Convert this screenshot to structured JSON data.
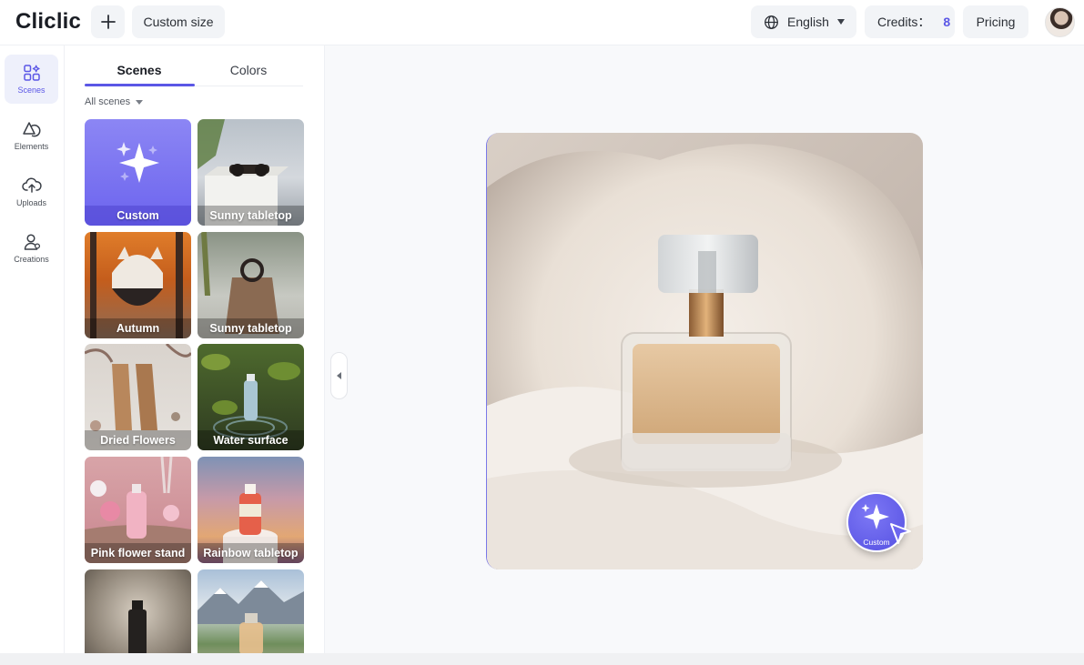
{
  "header": {
    "logo": "Cliclic",
    "custom_size_label": "Custom size",
    "language_label": "English",
    "credits_label": "Credits：",
    "credits_value": "8",
    "pricing_label": "Pricing"
  },
  "rail": {
    "items": [
      {
        "label": "Scenes",
        "icon": "grid-icon",
        "active": true
      },
      {
        "label": "Elements",
        "icon": "shapes-icon"
      },
      {
        "label": "Uploads",
        "icon": "cloud-upload-icon"
      },
      {
        "label": "Creations",
        "icon": "user-icon"
      }
    ]
  },
  "panel": {
    "tabs": [
      "Scenes",
      "Colors"
    ],
    "active_tab": "Scenes",
    "filter_label": "All scenes",
    "scenes": [
      {
        "label": "Custom"
      },
      {
        "label": "Sunny tabletop"
      },
      {
        "label": "Autumn"
      },
      {
        "label": "Sunny tabletop"
      },
      {
        "label": "Dried Flowers"
      },
      {
        "label": "Water surface"
      },
      {
        "label": "Pink flower stand"
      },
      {
        "label": "Rainbow tabletop"
      }
    ]
  },
  "canvas": {
    "fab_label": "Custom"
  },
  "colors": {
    "accent": "#5b57e6",
    "button_bg": "#f2f4f7",
    "canvas_bg": "#f8f9fb"
  }
}
